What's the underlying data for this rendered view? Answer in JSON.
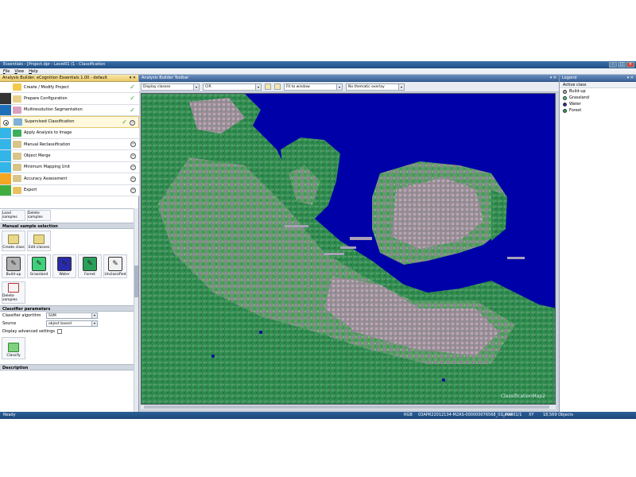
{
  "window": {
    "title": "Essentials - [Project.dpr - Level01 (1 - Classification",
    "buttons": [
      "–",
      "□",
      "×"
    ]
  },
  "menu": [
    "File",
    "View",
    "Help"
  ],
  "left_panel": {
    "title": "Analysis Builder: eCognition Essentials 1.00 - default",
    "controls": "▾ ✕",
    "steps": [
      {
        "label": "Create / Modify Project",
        "status": "check",
        "bar": "#ffffff",
        "icon": "#f2c94c"
      },
      {
        "label": "Prepare Configuration",
        "status": "check",
        "bar": "#333333",
        "icon": "#e8d08a"
      },
      {
        "label": "Multiresolution Segmentation",
        "status": "check",
        "bar": "#1e6fb8",
        "icon": "#d9a0c0"
      },
      {
        "label": "Supervised Classification",
        "status": "check-minus",
        "bar": "#ffffff",
        "icon": "#7fb0d8",
        "active": true
      },
      {
        "label": "Apply Analysis to Image",
        "status": "",
        "bar": "#33b5e8",
        "icon": "#3fae5a"
      },
      {
        "label": "Manual Reclassification",
        "status": "minus",
        "bar": "#33b5e8",
        "icon": "#d9c48a"
      },
      {
        "label": "Object Merge",
        "status": "minus",
        "bar": "#33b5e8",
        "icon": "#d9c48a"
      },
      {
        "label": "Minimum Mapping Unit",
        "status": "minus",
        "bar": "#33b5e8",
        "icon": "#d9c48a"
      },
      {
        "label": "Accuracy Assessment",
        "status": "minus",
        "bar": "#f5a623",
        "icon": "#d9c48a"
      },
      {
        "label": "Export",
        "status": "minus",
        "bar": "#3fae3f",
        "icon": "#e8c060"
      }
    ]
  },
  "sample_tools": {
    "load_label": "Load samples",
    "delete_label": "Delete samples"
  },
  "manual_sample": {
    "heading": "Manual sample selection",
    "create_label": "Create class",
    "edit_label": "Edit classes",
    "classes": [
      {
        "label": "Build-up",
        "color": "#b0b0b0"
      },
      {
        "label": "Grassland",
        "color": "#3fd07a"
      },
      {
        "label": "Water",
        "color": "#2a2aa8"
      },
      {
        "label": "Forest",
        "color": "#2aa05a"
      },
      {
        "label": "Unclassified",
        "color": "#f0f0f0"
      }
    ],
    "delete_samples_label": "Delete samples"
  },
  "classifier": {
    "heading": "Classifier parameters",
    "algorithm_label": "Classifier algorithm",
    "algorithm_value": "SVM",
    "source_label": "Source",
    "source_value": "object based",
    "advanced_label": "Display advanced settings",
    "classify_label": "Classify"
  },
  "description": {
    "heading": "Description"
  },
  "main_panel": {
    "title": "Analysis Builder Toolbar",
    "display_select": "Display classes",
    "mode_select": "CIR",
    "zoom_select": "Fit to window",
    "overlay_select": "No thematic overlay",
    "watermark": "ClassificationMap2"
  },
  "legend": {
    "title": "Legend",
    "header": "Active class",
    "items": [
      {
        "label": "Build-up",
        "color": "#b0b0b0"
      },
      {
        "label": "Grassland",
        "color": "#3fd07a"
      },
      {
        "label": "Water",
        "color": "#2a2aa8"
      },
      {
        "label": "Forest",
        "color": "#2aa05a"
      }
    ]
  },
  "status": {
    "ready": "Ready",
    "mode": "RGB",
    "image": "03APR22012134-M2AS-000000076568_01_P00",
    "level": "Level01/1",
    "xy": "XY",
    "objects": "18,569 Objects"
  },
  "colors": {
    "water": "#0000a8",
    "forest": "#2f8a4f",
    "grassland": "#5fc35a",
    "buildup": "#9a8a96"
  }
}
